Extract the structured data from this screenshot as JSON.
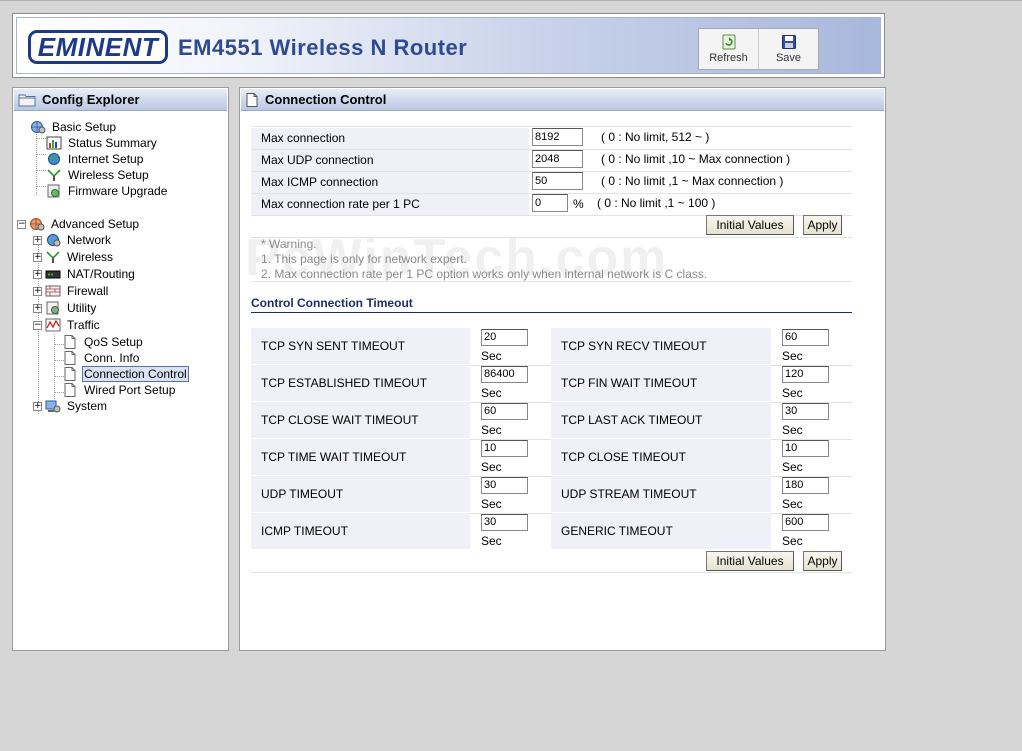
{
  "header": {
    "logo_text": "EMINENT",
    "title": "EM4551 Wireless N Router",
    "toolbar": {
      "refresh_label": "Refresh",
      "save_label": "Save"
    }
  },
  "sidebar": {
    "title": "Config Explorer",
    "items": [
      {
        "label": "Basic Setup"
      },
      {
        "label": "Status Summary"
      },
      {
        "label": "Internet Setup"
      },
      {
        "label": "Wireless Setup"
      },
      {
        "label": "Firmware Upgrade"
      },
      {
        "label": "Advanced Setup"
      },
      {
        "label": "Network"
      },
      {
        "label": "Wireless"
      },
      {
        "label": "NAT/Routing"
      },
      {
        "label": "Firewall"
      },
      {
        "label": "Utility"
      },
      {
        "label": "Traffic"
      },
      {
        "label": "QoS Setup"
      },
      {
        "label": "Conn. Info"
      },
      {
        "label": "Connection Control"
      },
      {
        "label": "Wired Port Setup"
      },
      {
        "label": "System"
      }
    ],
    "expander_plus": "+",
    "expander_minus": "−"
  },
  "main": {
    "title": "Connection Control",
    "connection": [
      {
        "label": "Max connection",
        "value": "8192",
        "hint": "( 0 : No limit, 512 ~ )"
      },
      {
        "label": "Max UDP connection",
        "value": "2048",
        "hint": "( 0 : No limit ,10 ~ Max connection )"
      },
      {
        "label": "Max ICMP connection",
        "value": "50",
        "hint": "( 0 : No limit ,1 ~ Max connection )"
      },
      {
        "label": "Max connection rate per 1 PC",
        "value": "0",
        "unit": "%",
        "hint": "( 0 : No limit ,1 ~ 100 )"
      }
    ],
    "buttons": {
      "initial_values": "Initial Values",
      "apply": "Apply"
    },
    "warning": [
      "* Warning.",
      "1. This page is only for network expert.",
      "2. Max connection rate per 1 PC option works only when internal network is C class."
    ],
    "timeout_title": "Control Connection Timeout",
    "unit": "Sec",
    "timeouts": [
      [
        {
          "label": "TCP SYN SENT TIMEOUT",
          "value": "20"
        },
        {
          "label": "TCP SYN RECV TIMEOUT",
          "value": "60"
        }
      ],
      [
        {
          "label": "TCP ESTABLISHED TIMEOUT",
          "value": "86400"
        },
        {
          "label": "TCP FIN WAIT TIMEOUT",
          "value": "120"
        }
      ],
      [
        {
          "label": "TCP CLOSE WAIT TIMEOUT",
          "value": "60"
        },
        {
          "label": "TCP LAST ACK TIMEOUT",
          "value": "30"
        }
      ],
      [
        {
          "label": "TCP TIME WAIT TIMEOUT",
          "value": "10"
        },
        {
          "label": "TCP CLOSE TIMEOUT",
          "value": "10"
        }
      ],
      [
        {
          "label": "UDP TIMEOUT",
          "value": "30"
        },
        {
          "label": "UDP STREAM TIMEOUT",
          "value": "180"
        }
      ],
      [
        {
          "label": "ICMP TIMEOUT",
          "value": "30"
        },
        {
          "label": "GENERIC TIMEOUT",
          "value": "600"
        }
      ]
    ]
  },
  "watermark": "PcWinTech.com",
  "colors": {
    "accent": "#2f4a8f",
    "panel_title_bg": "#b9c7e2",
    "row_shade": "#eff0f8"
  }
}
